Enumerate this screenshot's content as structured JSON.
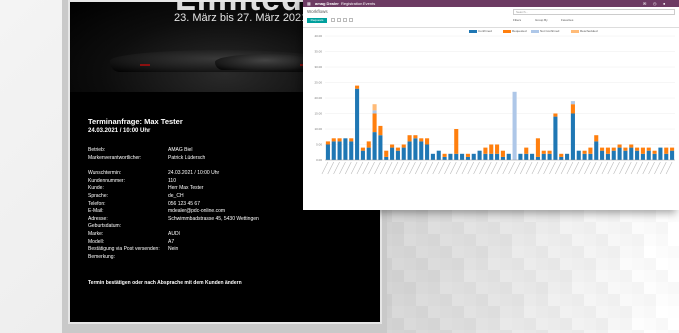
{
  "email": {
    "hero_title": "Limited Days",
    "hero_date": "23. März bis 27. März 2021",
    "heading": "Terminanfrage: Max Tester",
    "datetime": "24.03.2021 / 10:00 Uhr",
    "rows1": [
      {
        "k": "Betrieb:",
        "v": "AMAG Biel"
      },
      {
        "k": "Markenverantwortlicher:",
        "v": "Patrick Lüdersch"
      }
    ],
    "rows2": [
      {
        "k": "Wunschtermin:",
        "v": "24.03.2021 / 10:00 Uhr"
      },
      {
        "k": "Kundennummer:",
        "v": "110"
      },
      {
        "k": "Kunde:",
        "v": "Herr Max Tester"
      },
      {
        "k": "Sprache:",
        "v": "de_CH"
      },
      {
        "k": "Telefon:",
        "v": "056 123 45 67"
      },
      {
        "k": "E-Mail:",
        "v": "mdealer@pdc-online.com"
      },
      {
        "k": "Adresse:",
        "v": "Schwimmbadstrasse 45, 5430 Wettingen"
      },
      {
        "k": "Geburtsdatum:",
        "v": ""
      },
      {
        "k": "Marke:",
        "v": "AUDI"
      },
      {
        "k": "Modell:",
        "v": "A7"
      },
      {
        "k": "Bestätigung via Post versenden:",
        "v": "Nein"
      },
      {
        "k": "Bemerkung:",
        "v": ""
      }
    ],
    "footer": "Termin bestätigen oder nach Absprache mit dem Kunden ändern"
  },
  "dashboard": {
    "app_title": "amag Dealer",
    "menu": [
      "Registration",
      "Events"
    ],
    "breadcrumb": "Workflows",
    "search_placeholder": "Search...",
    "primary_button": "Requests",
    "filters": [
      "Filters",
      "Group By",
      "Favorites"
    ],
    "colors": {
      "topbar": "#6d3b63",
      "primary": "#00a09d"
    }
  },
  "chart_data": {
    "type": "bar",
    "stacked": true,
    "series": [
      {
        "name": "Confirmed",
        "color": "#1f77b4"
      },
      {
        "name": "Requested",
        "color": "#ff7f0e"
      },
      {
        "name": "Not Confirmed",
        "color": "#aec7e8"
      },
      {
        "name": "Rescheduled",
        "color": "#ffbb78"
      }
    ],
    "ylim": [
      0,
      40
    ],
    "yticks": [
      0,
      5,
      10,
      15,
      20,
      25,
      30,
      35,
      40
    ],
    "stacks": [
      [
        5,
        1,
        0,
        0
      ],
      [
        6,
        1,
        0,
        0
      ],
      [
        6,
        1,
        0,
        0
      ],
      [
        7,
        0,
        0,
        0
      ],
      [
        6,
        1,
        0,
        0
      ],
      [
        23,
        1,
        0,
        0
      ],
      [
        3,
        1,
        0,
        0
      ],
      [
        4,
        2,
        0,
        0
      ],
      [
        9,
        6,
        1,
        2
      ],
      [
        8,
        3,
        0,
        0
      ],
      [
        1,
        2,
        0,
        0
      ],
      [
        4,
        1,
        0,
        0
      ],
      [
        3,
        1,
        0,
        0
      ],
      [
        4,
        1,
        0,
        0
      ],
      [
        6,
        2,
        0,
        0
      ],
      [
        7,
        1,
        0,
        0
      ],
      [
        6,
        1,
        0,
        0
      ],
      [
        5,
        2,
        0,
        0
      ],
      [
        2,
        0,
        0,
        0
      ],
      [
        3,
        0,
        0,
        0
      ],
      [
        1,
        1,
        0,
        0
      ],
      [
        2,
        0,
        0,
        0
      ],
      [
        2,
        8,
        0,
        0
      ],
      [
        2,
        0,
        0,
        0
      ],
      [
        1,
        1,
        0,
        0
      ],
      [
        2,
        0,
        0,
        0
      ],
      [
        3,
        0,
        0,
        0
      ],
      [
        2,
        2,
        0,
        0
      ],
      [
        2,
        3,
        0,
        0
      ],
      [
        2,
        3,
        0,
        0
      ],
      [
        1,
        2,
        0,
        0
      ],
      [
        2,
        0,
        0,
        0
      ],
      [
        0,
        0,
        22,
        0
      ],
      [
        2,
        0,
        0,
        0
      ],
      [
        2,
        2,
        0,
        0
      ],
      [
        2,
        0,
        0,
        0
      ],
      [
        1,
        6,
        0,
        0
      ],
      [
        2,
        1,
        0,
        0
      ],
      [
        2,
        1,
        0,
        0
      ],
      [
        14,
        1,
        0,
        0
      ],
      [
        1,
        1,
        0,
        0
      ],
      [
        2,
        0,
        0,
        0
      ],
      [
        15,
        3,
        1,
        0
      ],
      [
        3,
        0,
        0,
        0
      ],
      [
        2,
        1,
        0,
        0
      ],
      [
        2,
        2,
        0,
        0
      ],
      [
        6,
        2,
        0,
        0
      ],
      [
        3,
        1,
        0,
        0
      ],
      [
        2,
        2,
        0,
        0
      ],
      [
        3,
        1,
        0,
        0
      ],
      [
        4,
        1,
        0,
        0
      ],
      [
        3,
        1,
        0,
        0
      ],
      [
        4,
        1,
        0,
        0
      ],
      [
        3,
        1,
        0,
        0
      ],
      [
        2,
        2,
        0,
        0
      ],
      [
        3,
        1,
        0,
        0
      ],
      [
        2,
        1,
        0,
        0
      ],
      [
        4,
        0,
        0,
        0
      ],
      [
        2,
        2,
        0,
        0
      ],
      [
        3,
        1,
        0,
        0
      ]
    ]
  }
}
